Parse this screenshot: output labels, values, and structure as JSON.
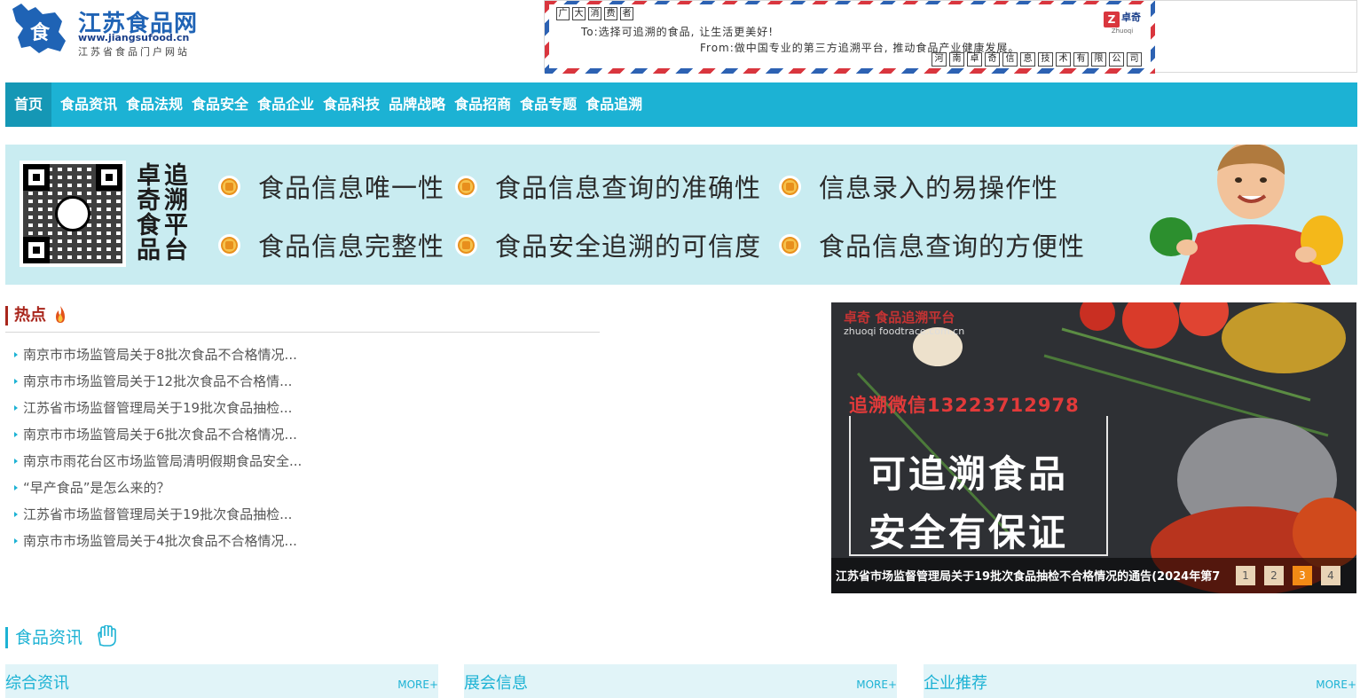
{
  "header": {
    "logo_name": "江苏食品网",
    "logo_url": "www.jiangsufood.cn",
    "logo_subtitle": "江苏省食品门户网站",
    "envelope": {
      "postal_boxes": [
        "广",
        "大",
        "消",
        "费",
        "者"
      ],
      "to_line": "To:选择可追溯的食品, 让生活更美好!",
      "from_line": "From:做中国专业的第三方追溯平台, 推动食品产业健康发展。",
      "company_chars": [
        "河",
        "南",
        "卓",
        "奇",
        "信",
        "息",
        "技",
        "术",
        "有",
        "限",
        "公",
        "司"
      ],
      "brand_mark": "Z",
      "brand_name": "卓奇",
      "brand_en": "Zhuoqi"
    }
  },
  "nav": {
    "items": [
      "首页",
      "食品资讯",
      "食品法规",
      "食品安全",
      "食品企业",
      "食品科技",
      "品牌战略",
      "食品招商",
      "食品专题",
      "食品追溯"
    ]
  },
  "banner": {
    "title_cols": [
      [
        "卓",
        "奇",
        "食",
        "品"
      ],
      [
        "追",
        "溯",
        "平",
        "台"
      ]
    ],
    "features": [
      "食品信息唯一性",
      "食品信息查询的准确性",
      "信息录入的易操作性",
      "食品信息完整性",
      "食品安全追溯的可信度",
      "食品信息查询的方便性"
    ]
  },
  "hot": {
    "title": "热点",
    "items": [
      "南京市市场监管局关于8批次食品不合格情况...",
      "南京市市场监管局关于12批次食品不合格情...",
      "江苏省市场监督管理局关于19批次食品抽检...",
      "南京市市场监管局关于6批次食品不合格情况...",
      "南京市雨花台区市场监管局清明假期食品安全...",
      "“早产食品”是怎么来的？",
      "江苏省市场监督管理局关于19批次食品抽检...",
      "南京市市场监管局关于4批次食品不合格情况..."
    ]
  },
  "slideshow": {
    "brand": "卓奇 食品追溯平台",
    "brand_url": "zhuoqi foodtrace.com.cn",
    "wechat": "追溯微信13223712978",
    "headline_1": "可追溯食品",
    "headline_2": "安全有保证",
    "caption": "江苏省市场监督管理局关于19批次食品抽检不合格情况的通告(2024年第7",
    "pages": [
      "1",
      "2",
      "3",
      "4"
    ],
    "active_page": "3"
  },
  "news": {
    "title": "食品资讯",
    "panels": [
      {
        "title": "综合资讯",
        "more": "MORE+"
      },
      {
        "title": "展会信息",
        "more": "MORE+"
      },
      {
        "title": "企业推荐",
        "more": "MORE+"
      }
    ]
  },
  "colors": {
    "nav": "#1cb2d4",
    "nav_active": "#1597b5",
    "hot_red": "#a9261c",
    "banner_bg": "#c9ecf1",
    "pager_active": "#f28a15"
  }
}
